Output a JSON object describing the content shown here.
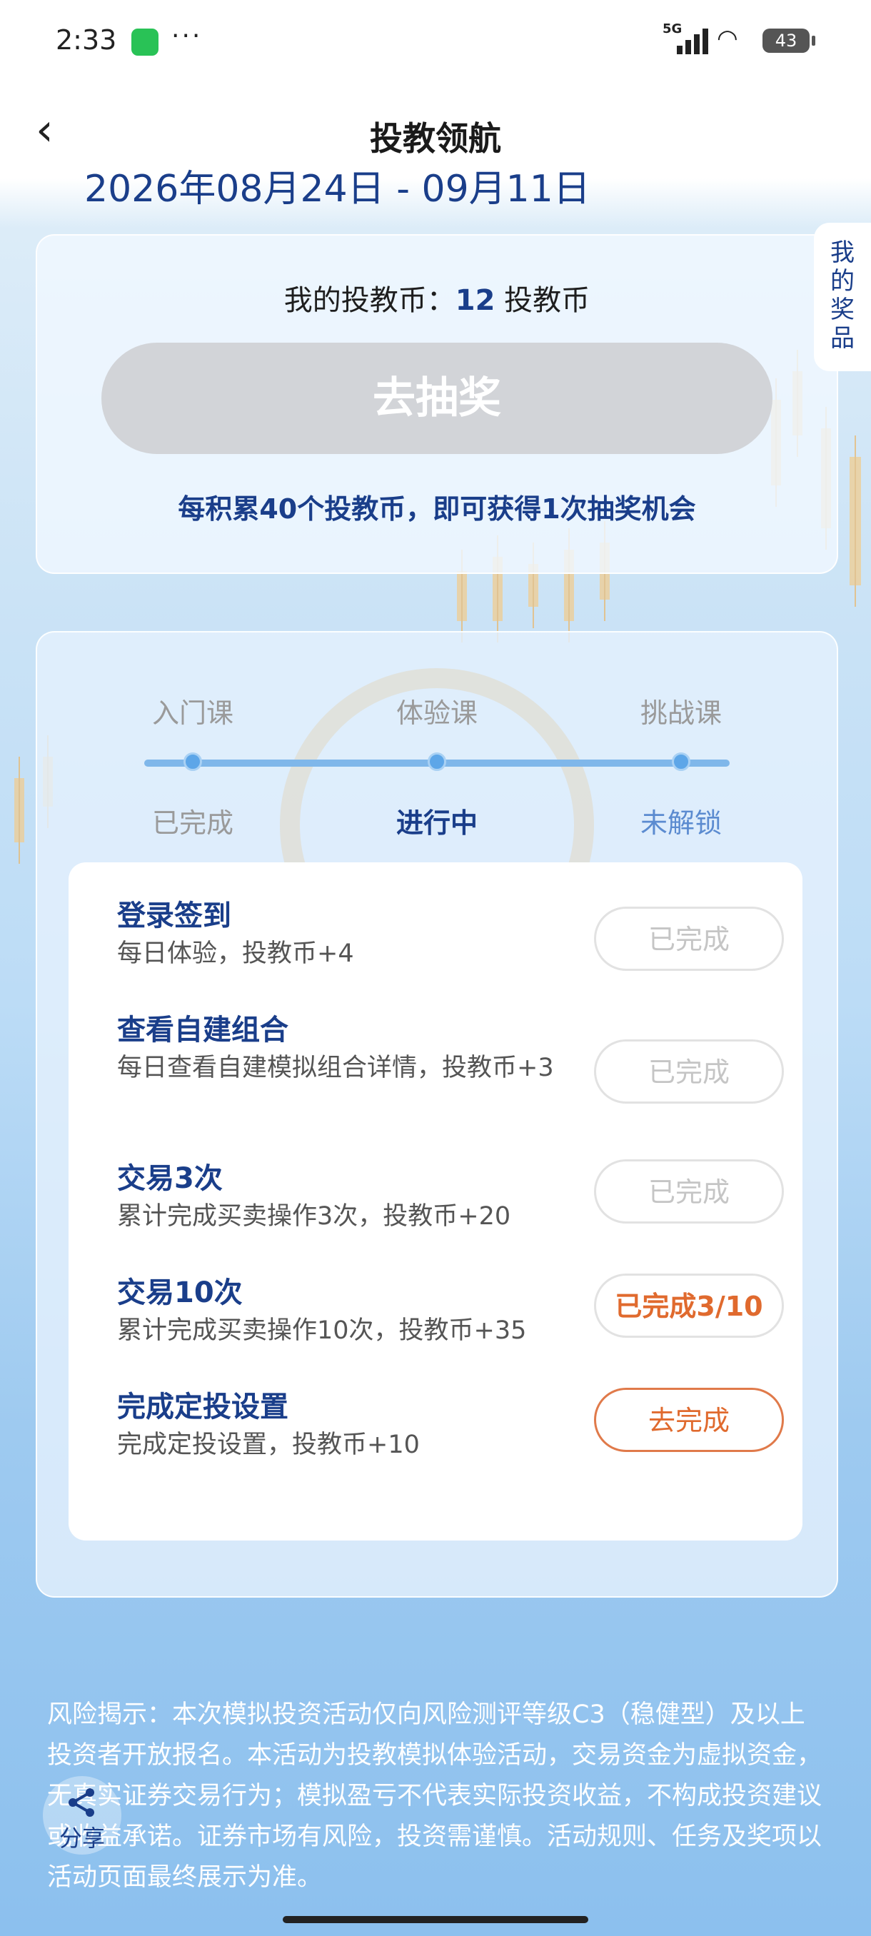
{
  "status_bar": {
    "time": "2:33",
    "more": "···",
    "network": "5G",
    "battery": "43"
  },
  "nav": {
    "title": "投教领航"
  },
  "date_range": "2026年08月24日 - 09月11日",
  "prize_tab": {
    "label": "我的奖品"
  },
  "coins": {
    "label": "我的投教币：",
    "amount": "12",
    "unit": " 投教币",
    "draw_button": "去抽奖",
    "tip": "每积累40个投教币，即可获得1次抽奖机会"
  },
  "courses": [
    {
      "name": "入门课",
      "status": "已完成",
      "status_color": "#9a9a9a"
    },
    {
      "name": "体验课",
      "status": "进行中",
      "status_color": "#1a3e8a"
    },
    {
      "name": "挑战课",
      "status": "未解锁",
      "status_color": "#5b8bd0"
    }
  ],
  "tasks": [
    {
      "title": "登录签到",
      "desc": "每日体验，投教币+4",
      "button": "已完成",
      "state": "done"
    },
    {
      "title": "查看自建组合",
      "desc": "每日查看自建模拟组合详情，投教币+3",
      "button": "已完成",
      "state": "done"
    },
    {
      "title": "交易3次",
      "desc": "累计完成买卖操作3次，投教币+20",
      "button": "已完成",
      "state": "done"
    },
    {
      "title": "交易10次",
      "desc": "累计完成买卖操作10次，投教币+35",
      "button": "已完成3/10",
      "state": "progress"
    },
    {
      "title": "完成定投设置",
      "desc": "完成定投设置，投教币+10",
      "button": "去完成",
      "state": "todo"
    }
  ],
  "risk_notice": "风险揭示：本次模拟投资活动仅向风险测评等级C3（稳健型）及以上投资者开放报名。本活动为投教模拟体验活动，交易资金为虚拟资金，无真实证券交易行为；模拟盈亏不代表实际投资收益，不构成投资建议或收益承诺。证券市场有风险，投资需谨慎。活动规则、任务及奖项以活动页面最终展示为准。",
  "share": {
    "label": "分享"
  },
  "colors": {
    "brand_blue": "#1a3e8a",
    "accent_orange": "#e06a2e",
    "disabled_gray": "#d2d4d8"
  }
}
